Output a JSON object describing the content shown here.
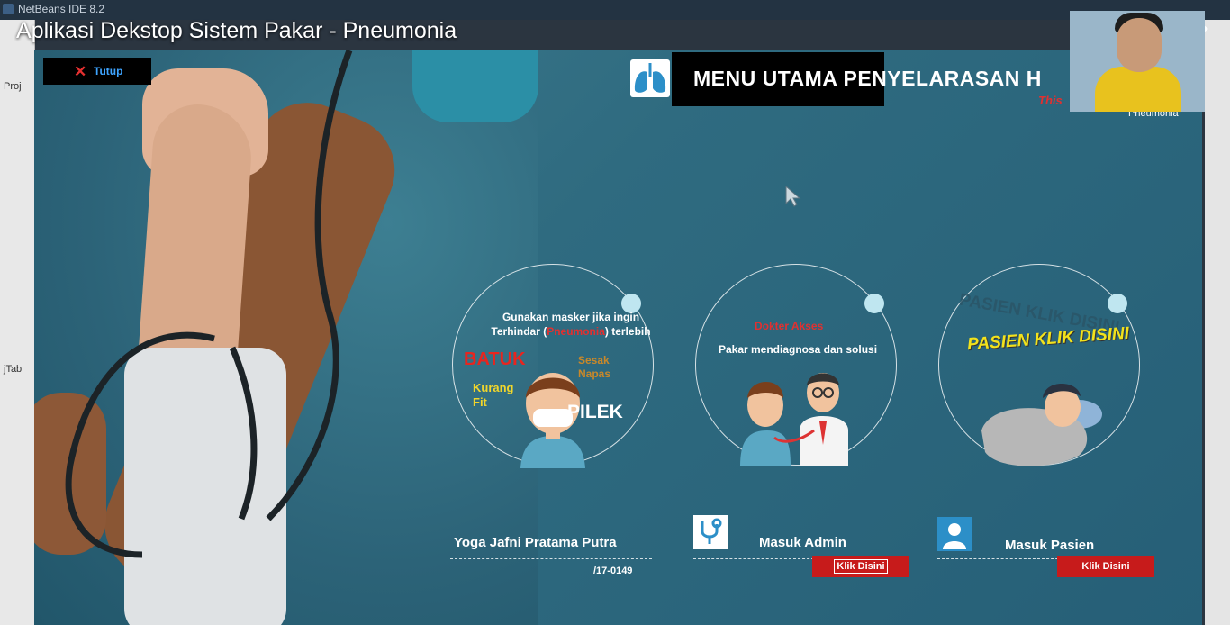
{
  "ide": {
    "title": "NetBeans IDE 8.2",
    "projects_label": "Proj",
    "tab_label": "jTab"
  },
  "video": {
    "title": "Aplikasi Dekstop Sistem Pakar - Pneumonia",
    "share_icon": "share-icon"
  },
  "app": {
    "close_button": "Tutup",
    "menu_title": "MENU UTAMA PENYELARASAN H",
    "menu_subtitle": "This",
    "pneumonia_small": "Pneumonia",
    "card1": {
      "line1": "Gunakan masker jika ingin",
      "line2_pre": "Terhindar (",
      "line2_red": "Pneumonia",
      "line2_post": ") terlebih",
      "batuk": "BATUK",
      "sesak": "Sesak",
      "napas": "Napas",
      "kurang": "Kurang",
      "fit": "Fit",
      "pilek": "PILEK"
    },
    "card2": {
      "dokter_akses": "Dokter Akses",
      "pakar": "Pakar mendiagnosa dan solusi"
    },
    "card3": {
      "ghost": "PASIEN KLIK DISINI",
      "pasien_klik": "PASIEN KLIK DISINI"
    },
    "author": "Yoga Jafni Pratama Putra",
    "nim": "/17-0149",
    "admin": {
      "label": "Masuk Admin",
      "button": "Klik Disini"
    },
    "pasien": {
      "label": "Masuk Pasien",
      "button": "Klik Disini"
    }
  },
  "colors": {
    "accent_red": "#c71b1b",
    "title_bar": "#000000",
    "background": "#2f6b80"
  }
}
